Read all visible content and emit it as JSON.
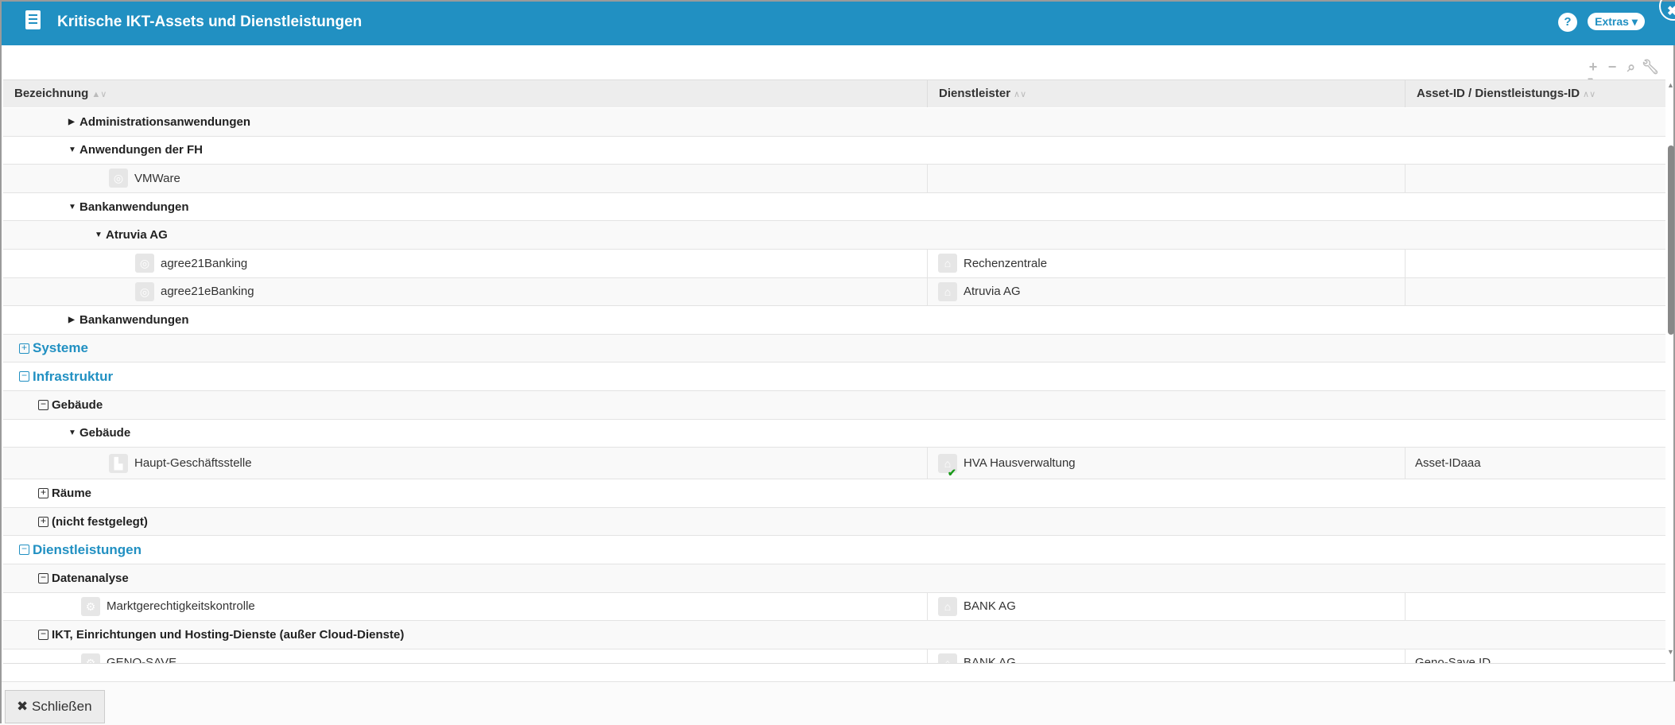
{
  "window": {
    "title": "Kritische IKT-Assets und Dienstleistungen",
    "help_label": "?",
    "extras_label": "Extras ▾",
    "close_icon": "close-icon"
  },
  "toolbar": {
    "icons": [
      "plus-icon",
      "minus-icon",
      "search-icon",
      "wrench-icon",
      "refresh-icon"
    ]
  },
  "table": {
    "columns": [
      "Bezeichnung",
      "Dienstleister",
      "Asset-ID / Dienstleistungs-ID"
    ],
    "rows": [
      {
        "kind": "group",
        "expander": "collapsed-arrow",
        "indent": 1,
        "label": "Administrationsanwendungen"
      },
      {
        "kind": "group",
        "expander": "expanded-arrow",
        "indent": 1,
        "label": "Anwendungen der FH"
      },
      {
        "kind": "item",
        "icon": "application-icon",
        "indent": 2,
        "label": "VMWare",
        "provider": "",
        "asset_id": ""
      },
      {
        "kind": "group",
        "expander": "expanded-arrow",
        "indent": 1,
        "label": "Bankanwendungen"
      },
      {
        "kind": "group",
        "expander": "expanded-arrow",
        "indent": 2,
        "label": "Atruvia AG"
      },
      {
        "kind": "item",
        "icon": "application-icon",
        "indent": 3,
        "label": "agree21Banking",
        "provider": "Rechenzentrale",
        "asset_id": ""
      },
      {
        "kind": "item",
        "icon": "application-icon",
        "indent": 3,
        "label": "agree21eBanking",
        "provider": "Atruvia AG",
        "asset_id": ""
      },
      {
        "kind": "group",
        "expander": "collapsed-arrow",
        "indent": 1,
        "label": "Bankanwendungen"
      },
      {
        "kind": "top",
        "expander": "plus-box",
        "indent": 0,
        "label": "Systeme"
      },
      {
        "kind": "top",
        "expander": "minus-box",
        "indent": 0,
        "label": "Infrastruktur"
      },
      {
        "kind": "group",
        "expander": "minus-box",
        "indent": 0.5,
        "label": "Gebäude"
      },
      {
        "kind": "group",
        "expander": "expanded-arrow",
        "indent": 1,
        "label": "Gebäude"
      },
      {
        "kind": "item",
        "icon": "building-icon",
        "indent": 2,
        "label": "Haupt-Geschäftsstelle",
        "provider": "HVA Hausverwaltung",
        "provider_verified": true,
        "asset_id": "Asset-IDaaa"
      },
      {
        "kind": "group",
        "expander": "plus-box",
        "indent": 0.5,
        "label": "Räume"
      },
      {
        "kind": "group",
        "expander": "plus-box",
        "indent": 0.5,
        "label": "(nicht festgelegt)"
      },
      {
        "kind": "top",
        "expander": "minus-box",
        "indent": 0,
        "label": "Dienstleistungen"
      },
      {
        "kind": "group",
        "expander": "minus-box",
        "indent": 0.5,
        "label": "Datenanalyse"
      },
      {
        "kind": "item",
        "icon": "gear-icon",
        "indent": 1.2,
        "label": "Marktgerechtigkeitskontrolle",
        "provider": "BANK AG",
        "asset_id": ""
      },
      {
        "kind": "group",
        "expander": "minus-box",
        "indent": 0.5,
        "label": "IKT, Einrichtungen und Hosting-Dienste (außer Cloud-Dienste)"
      },
      {
        "kind": "item",
        "icon": "gear-icon",
        "indent": 1.2,
        "label": "GENO-SAVE",
        "provider": "BANK AG",
        "asset_id": "Geno-Save ID"
      }
    ]
  },
  "footer": {
    "close_label": "Schließen"
  },
  "colors": {
    "accent": "#2190c2",
    "verified": "#1a9a1a"
  }
}
